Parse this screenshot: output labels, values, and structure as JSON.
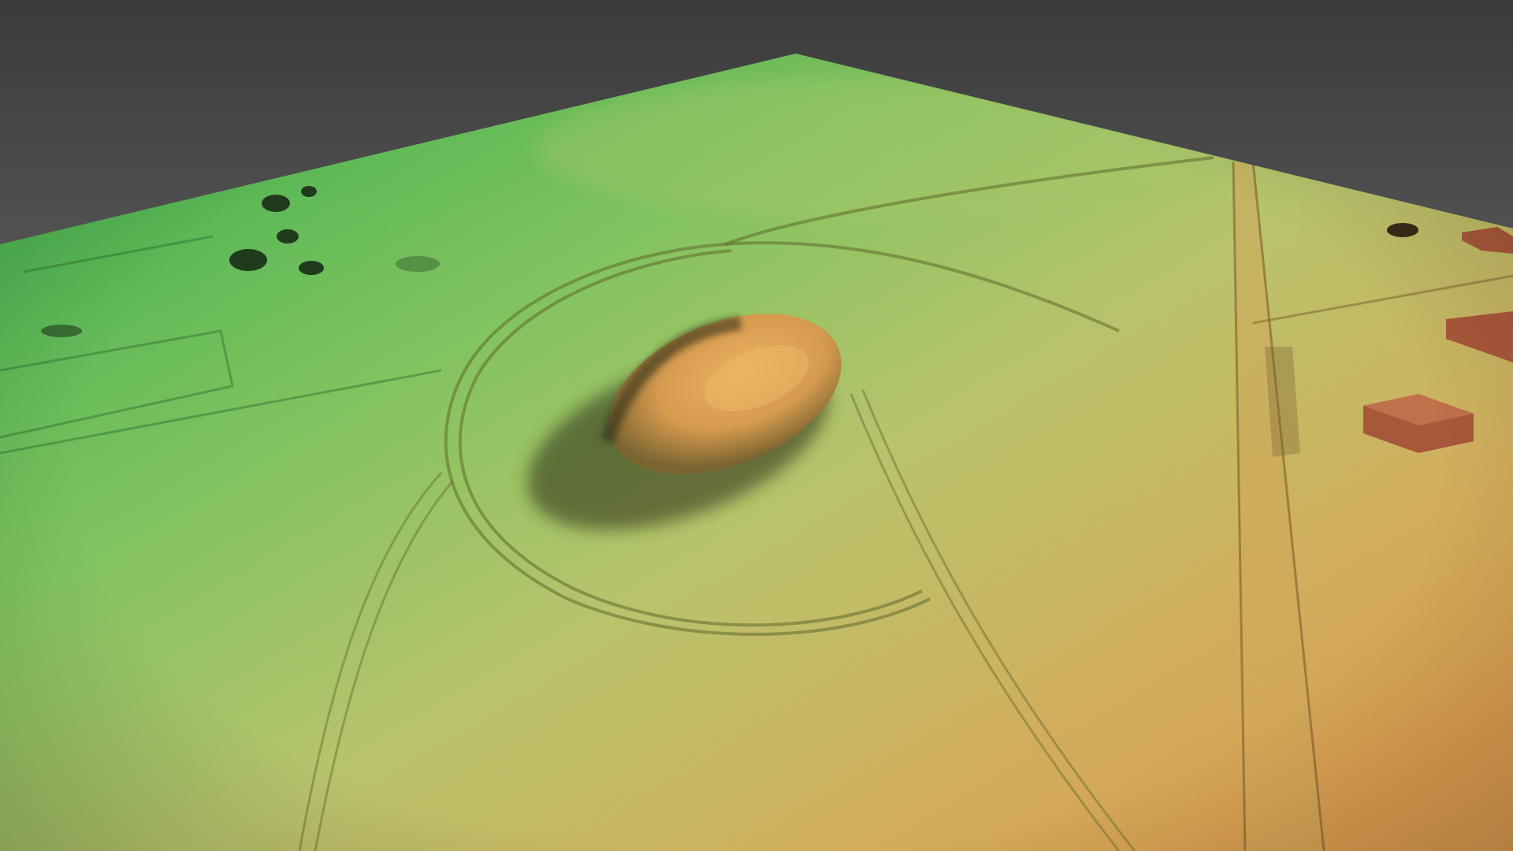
{
  "scene": {
    "kind": "lidar-terrain-render",
    "view": "oblique-perspective",
    "colors": {
      "sky_top": "#3b3b3b",
      "sky_bottom": "#8a8a8a",
      "terrain_low_green": "#3fb34a",
      "terrain_mid_green": "#8fc75a",
      "terrain_yellow": "#c9c264",
      "terrain_orange": "#d9a04c",
      "mound_top": "#e0a45a",
      "mound_shadow": "#3a3a1e",
      "roof": "#a8583a",
      "tree": "#1f3a1c"
    },
    "features": [
      "central-raised-mound",
      "enclosing-track",
      "straight-road",
      "field-boundaries",
      "tree-clusters",
      "buildings"
    ]
  }
}
